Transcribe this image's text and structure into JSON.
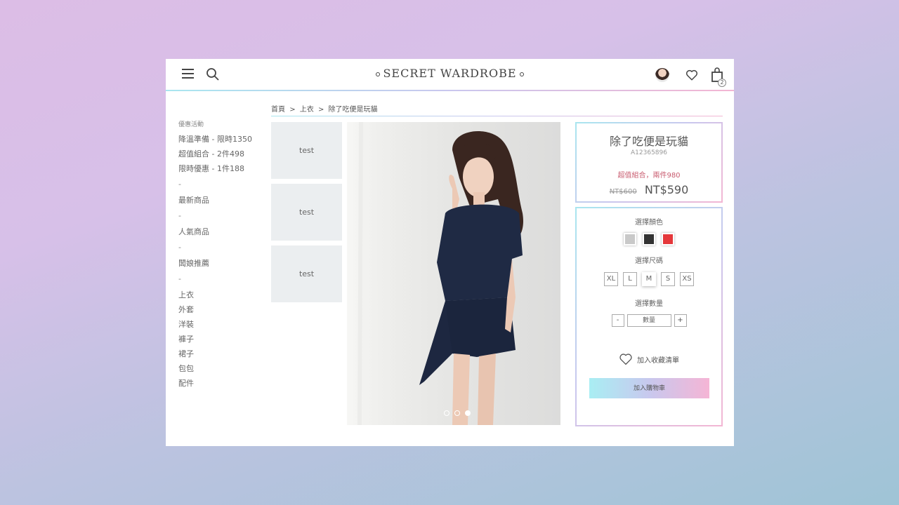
{
  "header": {
    "brand": "SECRET WARDROBE",
    "cart_count": "2"
  },
  "sidebar": {
    "promo_label": "優惠活動",
    "promos": [
      "降溫準備 - 限時1350",
      "超值組合 - 2件498",
      "限時優惠 - 1件188"
    ],
    "separator": "-",
    "new_items": "最新商品",
    "popular": "人氣商品",
    "recommend": "闆娘推薦",
    "categories": [
      "上衣",
      "外套",
      "洋裝",
      "褲子",
      "裙子",
      "包包",
      "配件"
    ]
  },
  "breadcrumb": {
    "home": "首頁",
    "sep": ">",
    "category": "上衣",
    "current": "除了吃便是玩貓"
  },
  "thumbnails": [
    "test",
    "test",
    "test"
  ],
  "carousel": {
    "count": 3,
    "active_index": 2
  },
  "product": {
    "name": "除了吃便是玩貓",
    "sku": "A12365896",
    "promo": "超值組合，兩件980",
    "old_price": "NT$600",
    "price": "NT$590"
  },
  "options": {
    "color_title": "選擇顏色",
    "colors": [
      "#c9c9c9",
      "#333333",
      "#e5383b"
    ],
    "size_title": "選擇尺碼",
    "sizes": [
      "XL",
      "L",
      "M",
      "S",
      "XS"
    ],
    "selected_size": "M",
    "qty_title": "選擇數量",
    "qty_minus": "-",
    "qty_placeholder": "數量",
    "qty_plus": "+",
    "wishlist": "加入收藏清單",
    "add_to_cart": "加入購物車"
  },
  "icons": [
    "menu-icon",
    "search-icon",
    "avatar",
    "heart-icon",
    "shopping-bag-icon"
  ]
}
